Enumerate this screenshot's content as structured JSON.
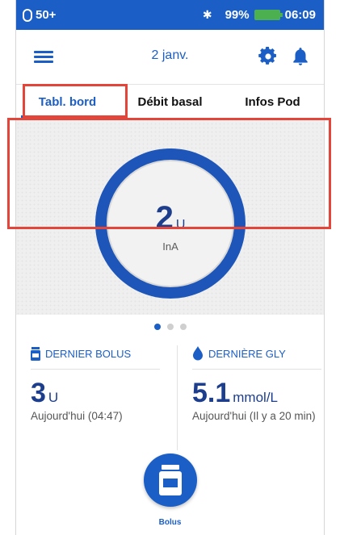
{
  "status_bar": {
    "pod_level": "50+",
    "battery": "99%",
    "time": "06:09"
  },
  "header": {
    "date": "2 janv."
  },
  "tabs": [
    {
      "label": "Tabl. bord",
      "active": true
    },
    {
      "label": "Débit basal",
      "active": false
    },
    {
      "label": "Infos Pod",
      "active": false
    }
  ],
  "dashboard": {
    "iob_value": "2",
    "iob_unit": "U",
    "iob_label": "InA",
    "page_count": 3,
    "active_page": 1
  },
  "last_bolus": {
    "title": "DERNIER BOLUS",
    "value": "3",
    "unit": "U",
    "time": "Aujourd'hui (04:47)"
  },
  "last_glucose": {
    "title": "DERNIÈRE GLY",
    "value": "5.1",
    "unit": "mmol/L",
    "time": "Aujourd'hui (Il y a 20 min)"
  },
  "bolus_button": {
    "label": "Bolus"
  },
  "colors": {
    "primary": "#1b5ec6",
    "ring": "#1d56b8",
    "highlight": "#e3453a",
    "battery": "#4caf50"
  }
}
